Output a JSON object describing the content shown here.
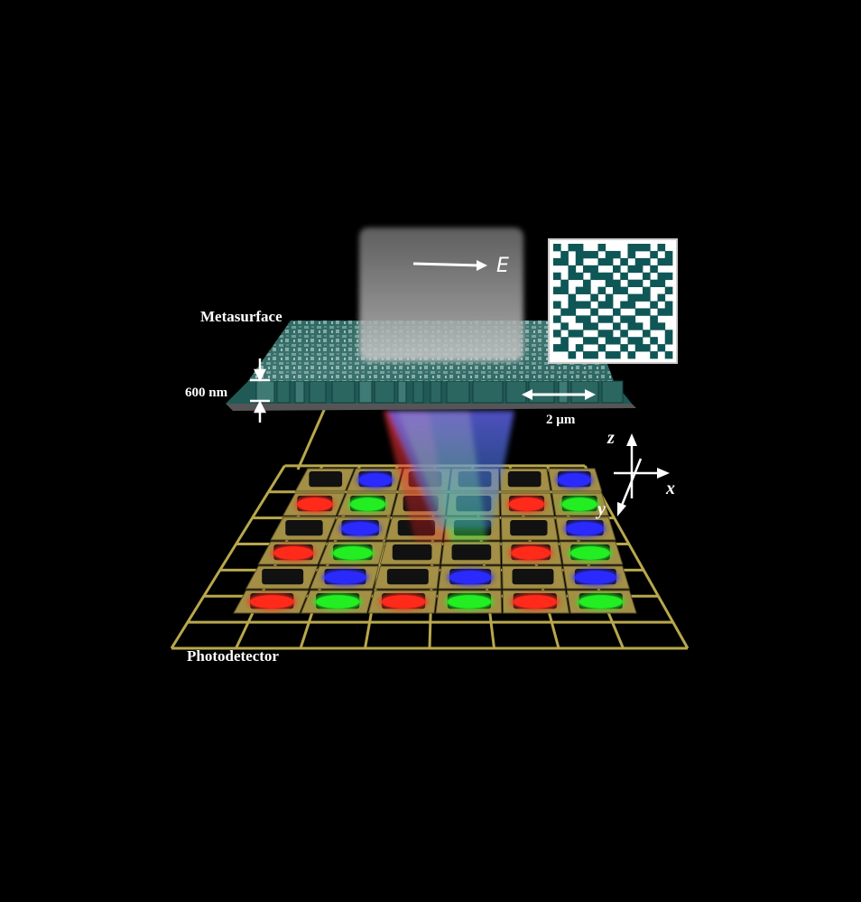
{
  "labels": {
    "metasurface": "Metasurface",
    "thickness": "600 nm",
    "scale": "2 µm",
    "photodetector": "Photodetector",
    "efield": "E"
  },
  "axes": {
    "z": "z",
    "x": "x",
    "y": "y"
  },
  "colors": {
    "background": "#000000",
    "metasurface": "#1f5a56",
    "pattern": "#0f5656",
    "grid": "#b8a84c",
    "red": "#ff2a1a",
    "green": "#22ee22",
    "blue": "#2a2aff"
  },
  "pixel_rows": [
    [
      "",
      "blue",
      "",
      "",
      "",
      "blue"
    ],
    [
      "red",
      "green",
      "",
      "",
      "red",
      "green"
    ],
    [
      "",
      "blue",
      "",
      "",
      "",
      "blue"
    ],
    [
      "red",
      "green",
      "",
      "",
      "red",
      "green"
    ],
    [
      "",
      "blue",
      "",
      "blue",
      "",
      "blue"
    ],
    [
      "red",
      "green",
      "red",
      "green",
      "red",
      "green"
    ]
  ],
  "pattern_grid": [
    "1011001000111010",
    "0101110110100101",
    "1101001101011011",
    "0010110010110100",
    "1011011101001011",
    "0100100110110110",
    "1101101011001001",
    "0010010100111010",
    "1011101101100101",
    "0110010010011011",
    "1001101101100100",
    "0100110010110110",
    "1011001101001001",
    "0100110110110101",
    "1101001001011010",
    "0010110110100101"
  ]
}
